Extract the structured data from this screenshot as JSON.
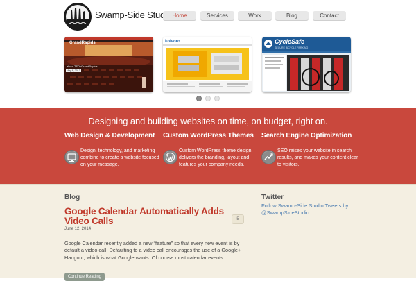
{
  "site": {
    "title": "Swamp-Side Studio"
  },
  "nav": {
    "items": [
      {
        "label": "Home",
        "active": true
      },
      {
        "label": "Services",
        "active": false
      },
      {
        "label": "Work",
        "active": false
      },
      {
        "label": "Blog",
        "active": false
      },
      {
        "label": "Contact",
        "active": false
      }
    ]
  },
  "slider": {
    "slides": [
      {
        "name": "Grand Rapids",
        "text_top": "GrandRapids",
        "text_caption": "about TEDxGrandRapids",
        "text_date": "May 6, 2013"
      },
      {
        "name": "Kolvoro",
        "text_top": "kolvoro"
      },
      {
        "name": "CycleSafe",
        "text_top": "CycleSafe",
        "text_sub": "SECURE BICYCLE PARKING"
      }
    ],
    "active_dot": 1,
    "dot_count": 3
  },
  "band": {
    "tagline": "Designing and building websites on time, on budget, right on.",
    "features": [
      {
        "title": "Web Design & Development",
        "text": "Design, technology, and marketing combine to create a website focused on your message.",
        "icon": "monitor-icon"
      },
      {
        "title": "Custom WordPress Themes",
        "text": "Custom WordPress theme design delivers the branding, layout and features your company needs.",
        "icon": "wordpress-icon"
      },
      {
        "title": "Search Engine Optimization",
        "text": "SEO raises your website in search results, and makes your content clear to visitors.",
        "icon": "trend-chart-icon"
      }
    ]
  },
  "blog": {
    "heading": "Blog",
    "post": {
      "title": "Google Calendar Automatically Adds Video Calls",
      "date": "June 12, 2014",
      "comments": "5",
      "excerpt": "Google Calendar recently added a new “feature” so that every new event is by default a video call. Defaulting to a video call encourages the use of a Google+ Hangout, which is what Google wants. Of course most calendar events…",
      "button": "Continue Reading"
    }
  },
  "twitter": {
    "heading": "Twitter",
    "text": "Follow Swamp-Side Studio Tweets by @SwampSideStudio"
  },
  "colors": {
    "accent_red": "#c9483d",
    "link_blue": "#4a7bb0",
    "cream": "#f4efe2"
  }
}
